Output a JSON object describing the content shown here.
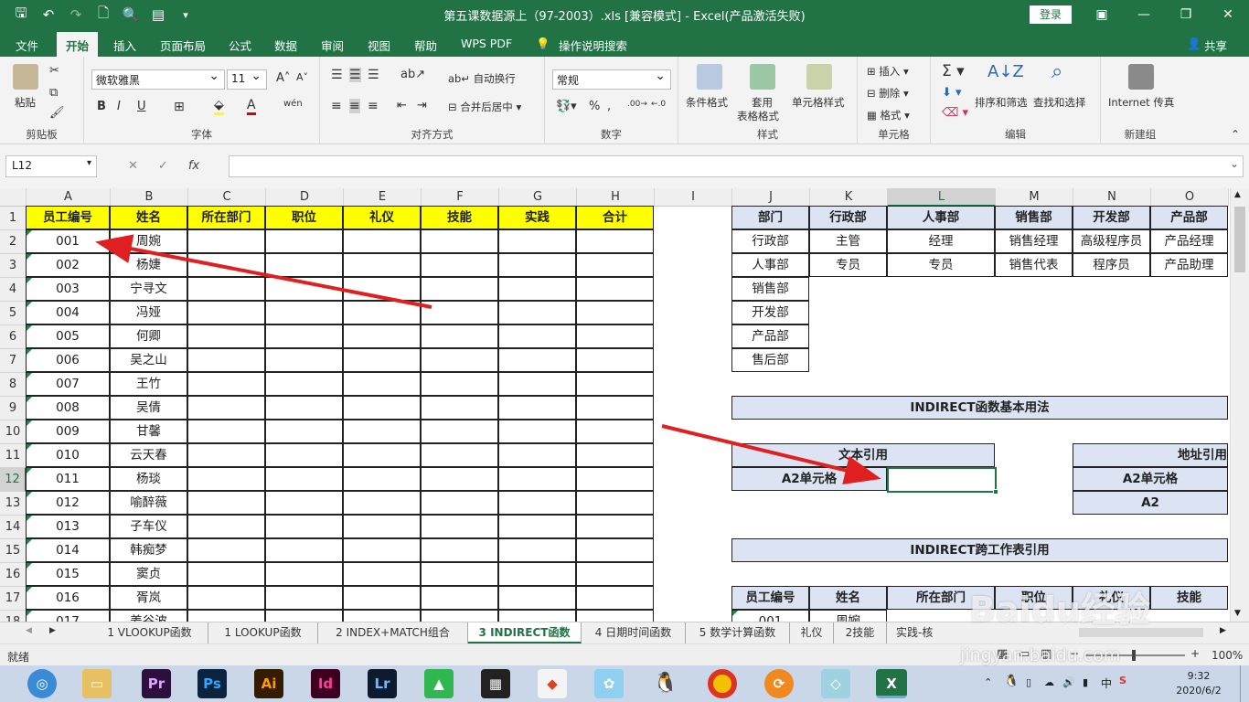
{
  "window": {
    "title": "第五课数据源上（97-2003）.xls  [兼容模式] - Excel(产品激活失败)",
    "login": "登录"
  },
  "ribbon_tabs": [
    "文件",
    "开始",
    "插入",
    "页面布局",
    "公式",
    "数据",
    "审阅",
    "视图",
    "帮助",
    "WPS PDF",
    "操作说明搜索"
  ],
  "share": "共享",
  "ribbon": {
    "paste": "粘贴",
    "clipboard": "剪贴板",
    "font_name": "微软雅黑",
    "font_size": "11",
    "font": "字体",
    "wrap": "自动换行",
    "merge": "合并后居中",
    "align": "对齐方式",
    "numfmt": "常规",
    "number": "数字",
    "cond": "条件格式",
    "table_fmt_1": "套用",
    "table_fmt_2": "表格格式",
    "cell_style": "单元格样式",
    "styles": "样式",
    "insert": "插入",
    "delete": "删除",
    "format": "格式",
    "cells": "单元格",
    "sort": "排序和筛选",
    "find": "查找和选择",
    "editing": "编辑",
    "internet": "Internet 传真",
    "new_group": "新建组"
  },
  "namebox": "L12",
  "fx": "fx",
  "columns": [
    "A",
    "B",
    "C",
    "D",
    "E",
    "F",
    "G",
    "H",
    "I",
    "J",
    "K",
    "L",
    "M",
    "N",
    "O"
  ],
  "rows": [
    "1",
    "2",
    "3",
    "4",
    "5",
    "6",
    "7",
    "8",
    "9",
    "10",
    "11",
    "12",
    "13",
    "14",
    "15",
    "16",
    "17",
    "18"
  ],
  "table1": {
    "headers": [
      "员工编号",
      "姓名",
      "所在部门",
      "职位",
      "礼仪",
      "技能",
      "实践",
      "合计"
    ],
    "ids": [
      "001",
      "002",
      "003",
      "004",
      "005",
      "006",
      "007",
      "008",
      "009",
      "010",
      "011",
      "012",
      "013",
      "014",
      "015",
      "016",
      "017"
    ],
    "names": [
      "周婉",
      "杨婕",
      "宁寻文",
      "冯娅",
      "何卿",
      "吴之山",
      "王竹",
      "吴倩",
      "甘馨",
      "云天春",
      "杨琰",
      "喻醉薇",
      "子车仪",
      "韩痴梦",
      "窦贞",
      "胥岚",
      "姜谷波"
    ]
  },
  "table2": {
    "headers": [
      "部门",
      "行政部",
      "人事部",
      "销售部",
      "开发部",
      "产品部"
    ],
    "col_j": [
      "行政部",
      "人事部",
      "销售部",
      "开发部",
      "产品部",
      "售后部"
    ],
    "row2": [
      "主管",
      "经理",
      "销售经理",
      "高级程序员",
      "产品经理"
    ],
    "row3": [
      "专员",
      "专员",
      "销售代表",
      "程序员",
      "产品助理"
    ]
  },
  "indirect": {
    "title": "INDIRECT函数基本用法",
    "text_ref": "文本引用",
    "addr_ref": "地址引用",
    "a2_cell": "A2单元格",
    "a2_cell2": "A2单元格",
    "a2": "A2",
    "cross_title": "INDIRECT跨工作表引用",
    "row17": [
      "员工编号",
      "姓名",
      "所在部门",
      "职位",
      "礼仪",
      "技能"
    ],
    "row18_id": "001",
    "row18_name": "周婉"
  },
  "sheet_tabs": [
    "1 VLOOKUP函数",
    "1 LOOKUP函数",
    "2 INDEX+MATCH组合",
    "3 INDIRECT函数",
    "4 日期时间函数",
    "5 数学计算函数",
    "礼仪",
    "2技能",
    "实践-核"
  ],
  "active_sheet": "3 INDIRECT函数",
  "status": {
    "ready": "就绪",
    "zoom": "100%"
  },
  "watermark": {
    "text": "Baidu经验",
    "url": "jingyan.baidu.com"
  },
  "taskbar": {
    "apps": [
      "Pr",
      "Ps",
      "Ai",
      "Id",
      "Lr"
    ],
    "time": "9:32",
    "date": "2020/6/2",
    "ime": "中"
  },
  "colors": {
    "green": "#217346",
    "yellow": "#ffff00",
    "header_blue": "#dce3f2",
    "arrow": "#e02020"
  }
}
